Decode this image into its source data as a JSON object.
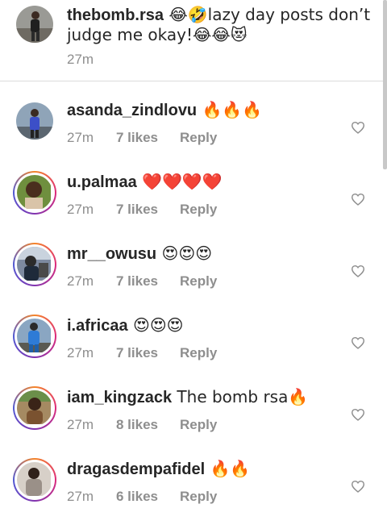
{
  "caption": {
    "username": "thebomb.rsa",
    "text": " 😂🤣lazy day posts don’t judge me okay!😂😂😻",
    "time": "27m"
  },
  "comments": [
    {
      "username": "asanda_zindlovu",
      "text": " 🔥🔥🔥",
      "time": "27m",
      "likes": "7 likes",
      "reply": "Reply",
      "story_ring": false
    },
    {
      "username": "u.palmaa",
      "text": " ❤️❤️❤️❤️",
      "time": "27m",
      "likes": "7 likes",
      "reply": "Reply",
      "story_ring": true
    },
    {
      "username": "mr__owusu",
      "text": " 😍😍😍",
      "time": "27m",
      "likes": "7 likes",
      "reply": "Reply",
      "story_ring": true
    },
    {
      "username": "i.africaa",
      "text": " 😍😍😍",
      "time": "27m",
      "likes": "7 likes",
      "reply": "Reply",
      "story_ring": true
    },
    {
      "username": "iam_kingzack",
      "text": " The bomb rsa🔥",
      "time": "27m",
      "likes": "8 likes",
      "reply": "Reply",
      "story_ring": true
    },
    {
      "username": "dragasdempafidel",
      "text": " 🔥🔥",
      "time": "27m",
      "likes": "6 likes",
      "reply": "Reply",
      "story_ring": true
    }
  ],
  "icons": {
    "like": "heart-outline-icon"
  },
  "colors": {
    "text": "#262626",
    "secondary": "#8e8e8e",
    "divider": "#dbdbdb",
    "story_gradient": [
      "#f58529",
      "#dd2a7b",
      "#8134af",
      "#515bd4"
    ]
  }
}
